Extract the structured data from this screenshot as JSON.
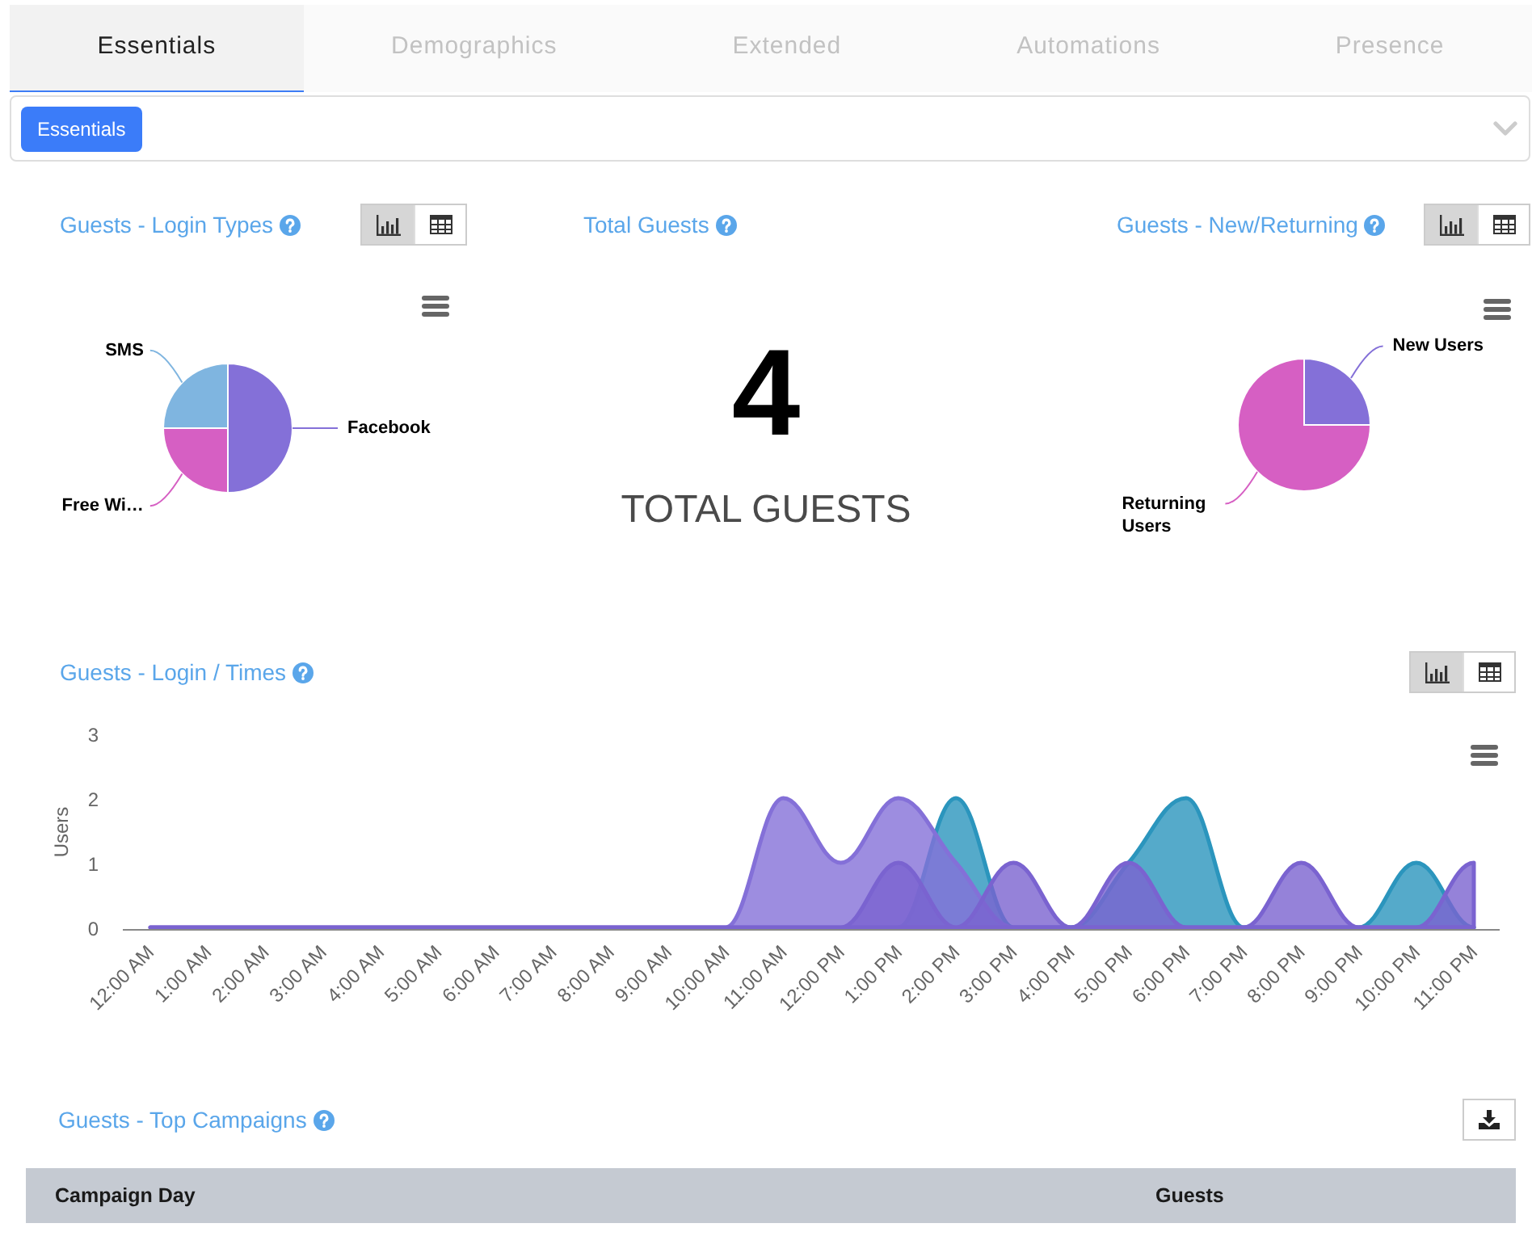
{
  "tabs": [
    {
      "label": "Essentials",
      "selected": true
    },
    {
      "label": "Demographics",
      "selected": false
    },
    {
      "label": "Extended",
      "selected": false
    },
    {
      "label": "Automations",
      "selected": false
    },
    {
      "label": "Presence",
      "selected": false
    }
  ],
  "filter": {
    "tags": [
      "Essentials"
    ]
  },
  "login_types": {
    "title": "Guests - Login Types",
    "view_toggle": [
      {
        "kind": "chart",
        "selected": true
      },
      {
        "kind": "table",
        "selected": false
      }
    ],
    "chart_data": {
      "type": "pie",
      "categories": [
        "Facebook",
        "Free Wi…",
        "SMS"
      ],
      "values": [
        50,
        25,
        25
      ]
    }
  },
  "total_guests": {
    "title": "Total Guests",
    "value": "4",
    "caption": "TOTAL GUESTS"
  },
  "new_returning": {
    "title": "Guests - New/Returning",
    "view_toggle": [
      {
        "kind": "chart",
        "selected": true
      },
      {
        "kind": "table",
        "selected": false
      }
    ],
    "chart_data": {
      "type": "pie",
      "categories": [
        "New Users",
        "Returning Users"
      ],
      "values": [
        25,
        75
      ]
    }
  },
  "login_times": {
    "title": "Guests - Login / Times",
    "view_toggle": [
      {
        "kind": "chart",
        "selected": true
      },
      {
        "kind": "table",
        "selected": false
      }
    ],
    "chart_data": {
      "type": "area",
      "categories": [
        "12:00 AM",
        "1:00 AM",
        "2:00 AM",
        "3:00 AM",
        "4:00 AM",
        "5:00 AM",
        "6:00 AM",
        "7:00 AM",
        "8:00 AM",
        "9:00 AM",
        "10:00 AM",
        "11:00 AM",
        "12:00 PM",
        "1:00 PM",
        "2:00 PM",
        "3:00 PM",
        "4:00 PM",
        "5:00 PM",
        "6:00 PM",
        "7:00 PM",
        "8:00 PM",
        "9:00 PM",
        "10:00 PM",
        "11:00 PM"
      ],
      "ylabel": "Users",
      "ylim": [
        0,
        3
      ],
      "yticks": [
        0,
        1,
        2,
        3
      ],
      "series": [
        {
          "color": "#2b95bd",
          "values": [
            null,
            null,
            null,
            null,
            null,
            null,
            null,
            null,
            null,
            null,
            null,
            null,
            null,
            0,
            2,
            0,
            0,
            1,
            2,
            0,
            0,
            0,
            1,
            0
          ]
        },
        {
          "color": "#8470d8",
          "values": [
            0,
            0,
            0,
            0,
            0,
            0,
            0,
            0,
            0,
            0,
            0,
            2,
            1,
            2,
            1,
            0,
            0,
            0,
            0,
            0,
            0,
            0,
            0,
            0
          ]
        },
        {
          "color": "#7a63d0",
          "values": [
            0,
            0,
            0,
            0,
            0,
            0,
            0,
            0,
            0,
            0,
            0,
            0,
            0,
            1,
            0,
            1,
            0,
            1,
            0,
            0,
            1,
            0,
            0,
            1
          ]
        }
      ]
    }
  },
  "top_campaigns": {
    "title": "Guests - Top Campaigns",
    "table": {
      "columns": [
        "Campaign Day",
        "Guests"
      ]
    }
  }
}
